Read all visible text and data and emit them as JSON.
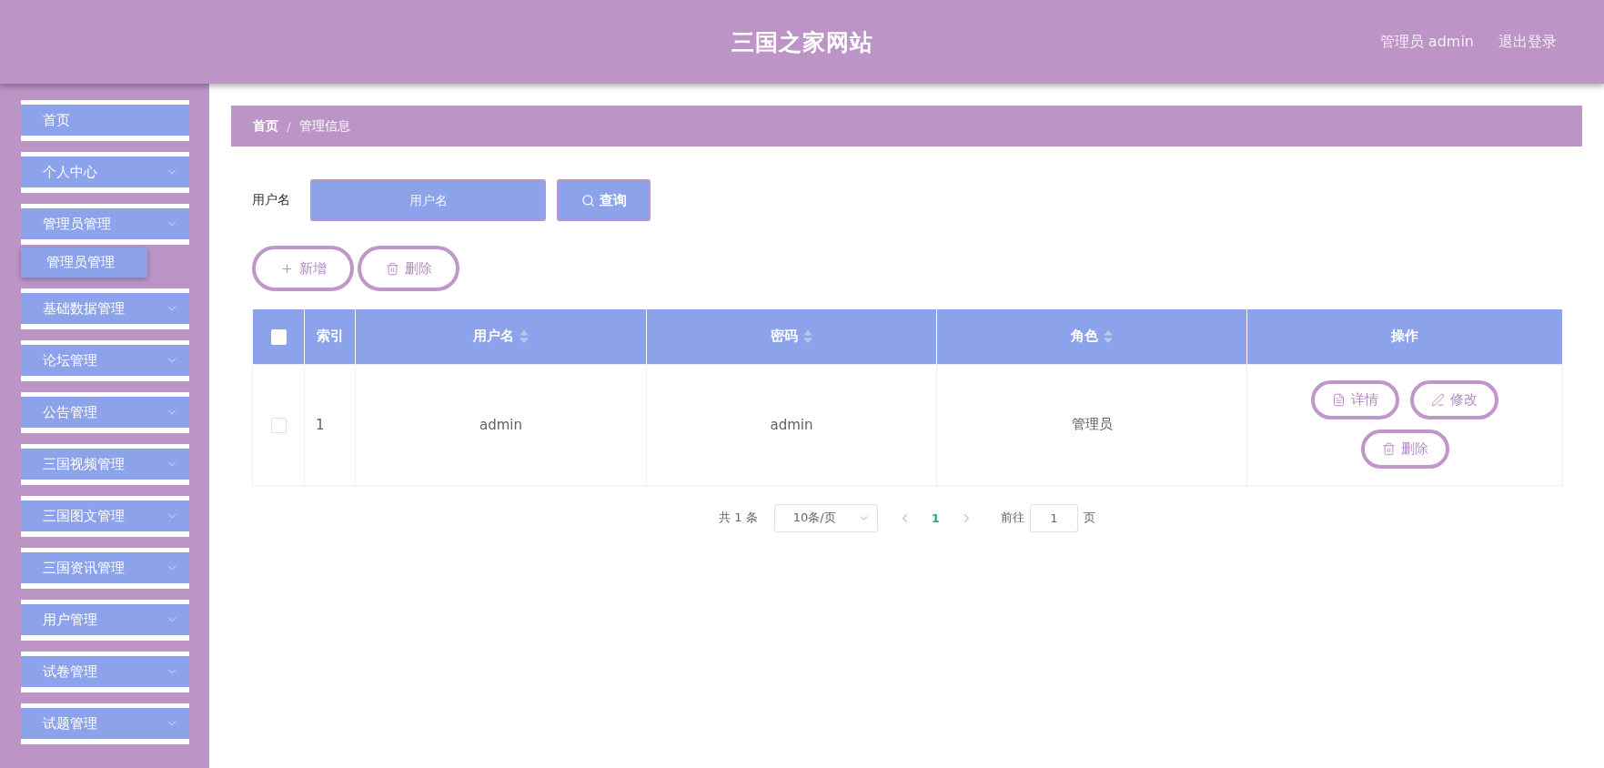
{
  "header": {
    "title": "三国之家网站",
    "user": "管理员 admin",
    "logout": "退出登录"
  },
  "sidebar": {
    "items": [
      {
        "label": "首页",
        "kind": "link"
      },
      {
        "label": "个人中心",
        "kind": "submenu"
      },
      {
        "label": "管理员管理",
        "kind": "submenu",
        "children": [
          {
            "label": "管理员管理"
          }
        ]
      },
      {
        "label": "基础数据管理",
        "kind": "submenu"
      },
      {
        "label": "论坛管理",
        "kind": "submenu"
      },
      {
        "label": "公告管理",
        "kind": "submenu"
      },
      {
        "label": "三国视频管理",
        "kind": "submenu"
      },
      {
        "label": "三国图文管理",
        "kind": "submenu"
      },
      {
        "label": "三国资讯管理",
        "kind": "submenu"
      },
      {
        "label": "用户管理",
        "kind": "submenu"
      },
      {
        "label": "试卷管理",
        "kind": "submenu"
      },
      {
        "label": "试题管理",
        "kind": "submenu"
      }
    ]
  },
  "breadcrumb": {
    "items": [
      {
        "label": "首页"
      },
      {
        "label": "管理信息"
      }
    ],
    "separator": "/"
  },
  "search": {
    "label": "用户名",
    "placeholder": "用户名",
    "button": "查询"
  },
  "actions": [
    {
      "kind": "add",
      "label": "新增"
    },
    {
      "kind": "delete",
      "label": "删除"
    }
  ],
  "table": {
    "select_all": {
      "checked": false
    },
    "columns": [
      {
        "label": "索引",
        "sortable": false
      },
      {
        "label": "用户名",
        "sortable": true
      },
      {
        "label": "密码",
        "sortable": true
      },
      {
        "label": "角色",
        "sortable": true
      },
      {
        "label": "操作",
        "sortable": false
      }
    ],
    "rows": [
      {
        "checked": false,
        "cells": [
          "1",
          "admin",
          "admin",
          "管理员"
        ],
        "actions": [
          {
            "kind": "detail",
            "label": "详情"
          },
          {
            "kind": "edit",
            "label": "修改"
          },
          {
            "kind": "delete",
            "label": "删除"
          }
        ]
      }
    ]
  },
  "pagination": {
    "total": "共 1 条",
    "page_size": "10条/页",
    "pages": [
      {
        "label": "1",
        "selected": true
      }
    ],
    "goto_label": "前往",
    "goto_value": "1",
    "goto_suffix": "页"
  }
}
